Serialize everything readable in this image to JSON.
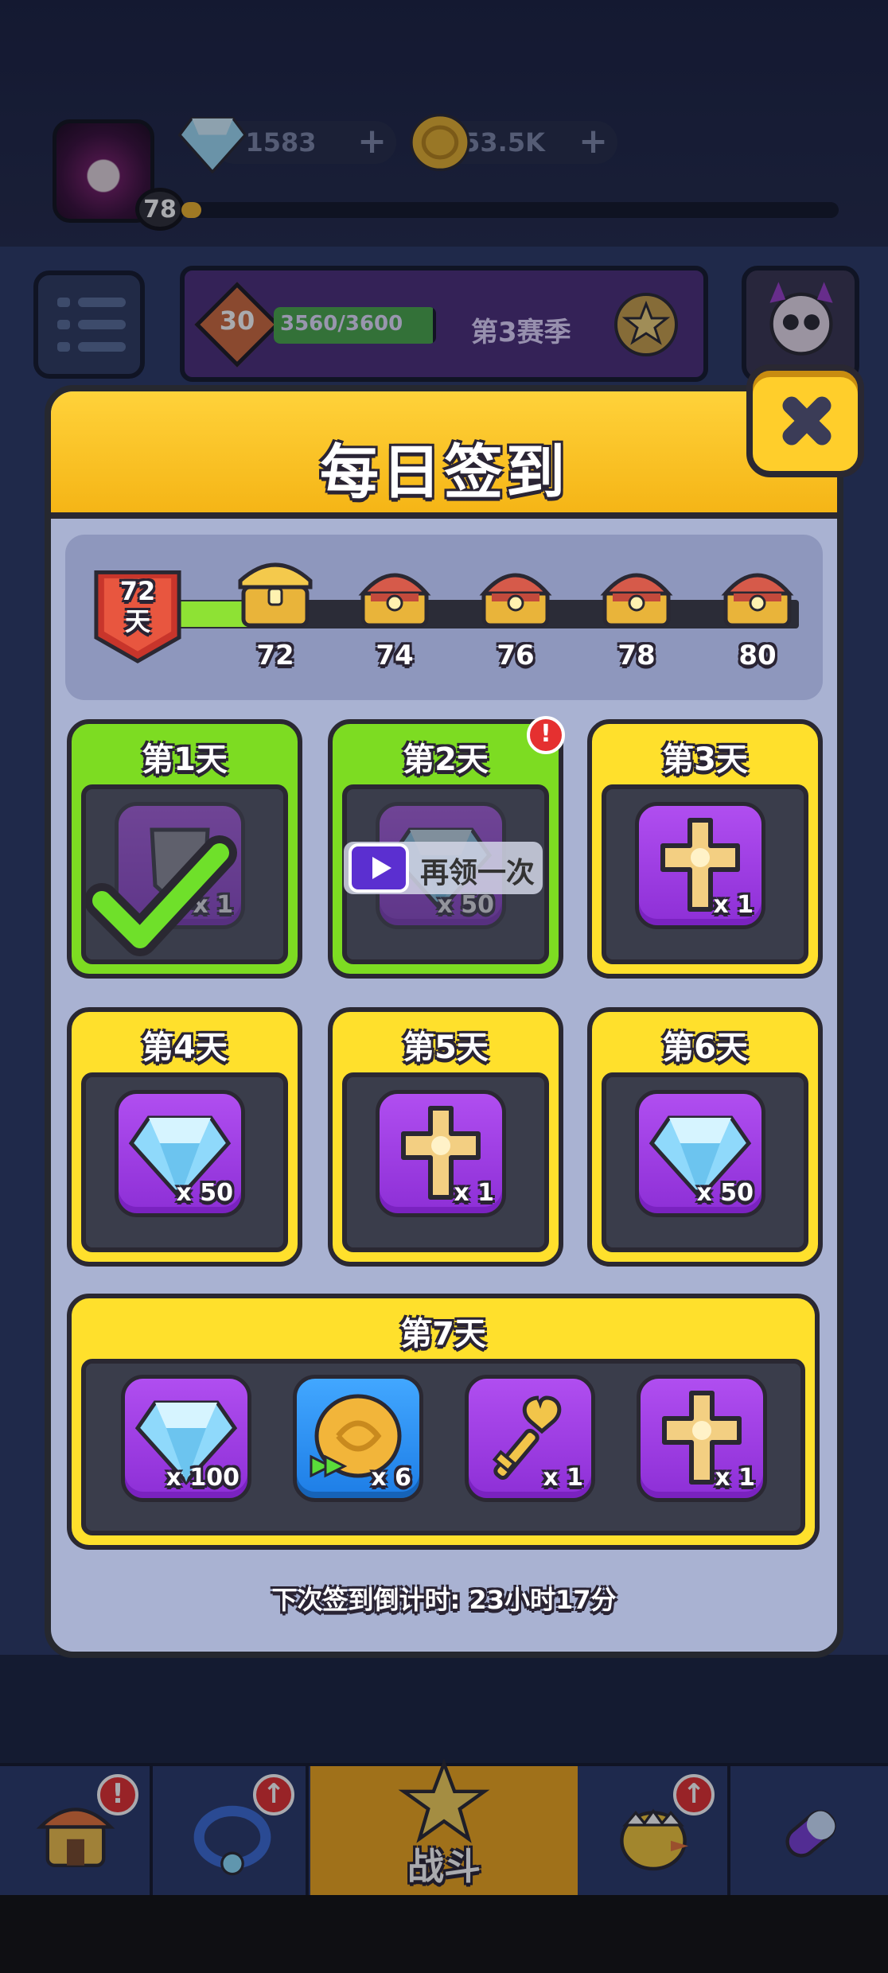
{
  "player": {
    "level": "78",
    "gems": "1583",
    "coins": "53.5K"
  },
  "season": {
    "level": "30",
    "progress_text": "3560/3600",
    "progress_fraction": 0.989,
    "name": "第3赛季"
  },
  "modal": {
    "title": "每日签到",
    "streak_days": "72",
    "streak_unit": "天",
    "milestones": [
      "72",
      "74",
      "76",
      "78",
      "80"
    ],
    "days": [
      {
        "title": "第1天",
        "status": "claimed",
        "reward": "shield-icon",
        "qty": "x 1"
      },
      {
        "title": "第2天",
        "status": "claimed",
        "reward": "gem-icon",
        "qty": "x 50",
        "action": "再领一次"
      },
      {
        "title": "第3天",
        "status": "pending",
        "reward": "cross-icon",
        "qty": "x 1"
      },
      {
        "title": "第4天",
        "status": "pending",
        "reward": "gem-icon",
        "qty": "x 50"
      },
      {
        "title": "第5天",
        "status": "pending",
        "reward": "cross-icon",
        "qty": "x 1"
      },
      {
        "title": "第6天",
        "status": "pending",
        "reward": "gem-icon",
        "qty": "x 50"
      }
    ],
    "day7": {
      "title": "第7天",
      "rewards": [
        {
          "icon": "gem-icon",
          "qty": "x 100"
        },
        {
          "icon": "coin-icon",
          "qty": "x 6"
        },
        {
          "icon": "key-icon",
          "qty": "x 1"
        },
        {
          "icon": "cross-icon",
          "qty": "x 1"
        }
      ]
    },
    "countdown": "下次签到倒计时: 23小时17分"
  },
  "nav": {
    "battle_label": "战斗"
  },
  "alerts": {
    "mark": "!"
  },
  "colors": {
    "claimed": "#7ddc22",
    "pending": "#ffe02c",
    "header": "#f5b516",
    "reward_purple": "#9b3be3",
    "reward_blue": "#2a8ff0"
  }
}
